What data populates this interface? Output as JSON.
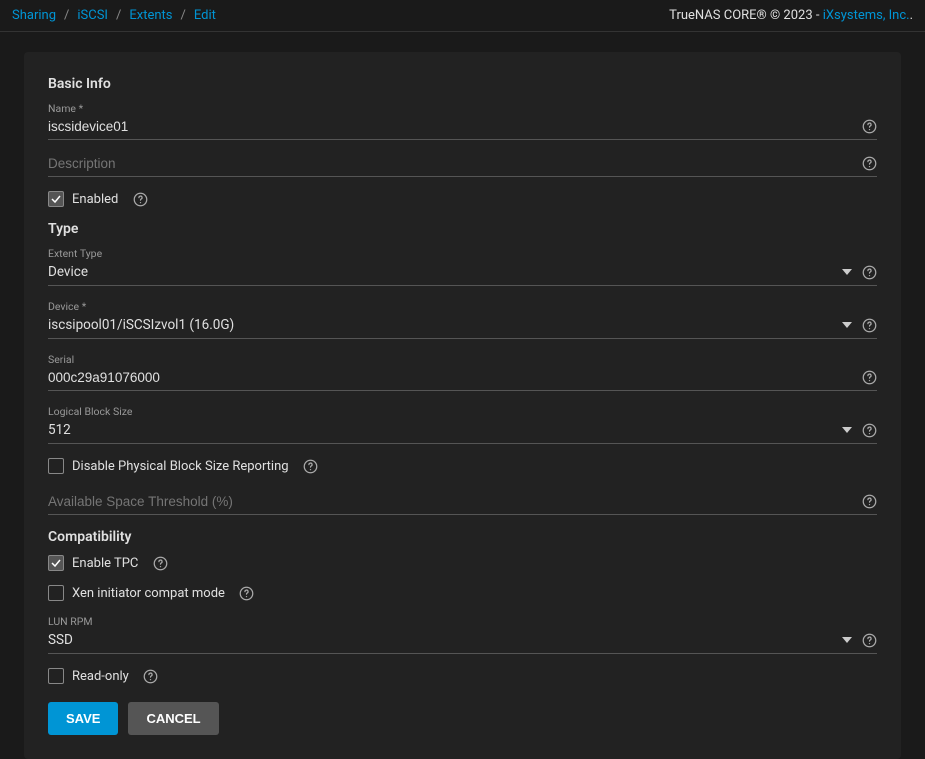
{
  "breadcrumbs": [
    "Sharing",
    "iSCSI",
    "Extents",
    "Edit"
  ],
  "copyright": "TrueNAS CORE® © 2023 - ",
  "copyright_link": "iXsystems, Inc.",
  "sections": {
    "basic": {
      "title": "Basic Info",
      "name_label": "Name *",
      "name_value": "iscsidevice01",
      "description_label": "Description",
      "description_value": "",
      "enabled_label": "Enabled",
      "enabled_checked": true
    },
    "type": {
      "title": "Type",
      "extent_type_label": "Extent Type",
      "extent_type_value": "Device",
      "device_label": "Device *",
      "device_value": "iscsipool01/iSCSIzvol1 (16.0G)",
      "serial_label": "Serial",
      "serial_value": "000c29a91076000",
      "lbs_label": "Logical Block Size",
      "lbs_value": "512",
      "disable_pbs_label": "Disable Physical Block Size Reporting",
      "disable_pbs_checked": false,
      "threshold_label": "Available Space Threshold (%)",
      "threshold_value": ""
    },
    "compat": {
      "title": "Compatibility",
      "tpc_label": "Enable TPC",
      "tpc_checked": true,
      "xen_label": "Xen initiator compat mode",
      "xen_checked": false,
      "lunrpm_label": "LUN RPM",
      "lunrpm_value": "SSD",
      "readonly_label": "Read-only",
      "readonly_checked": false
    }
  },
  "buttons": {
    "save": "SAVE",
    "cancel": "CANCEL"
  }
}
